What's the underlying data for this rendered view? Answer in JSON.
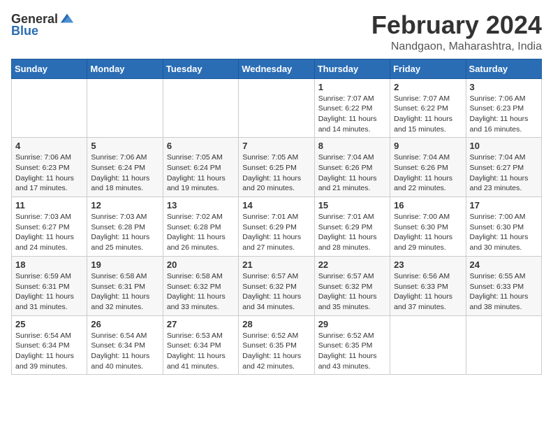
{
  "header": {
    "logo_general": "General",
    "logo_blue": "Blue",
    "month_year": "February 2024",
    "location": "Nandgaon, Maharashtra, India"
  },
  "days_of_week": [
    "Sunday",
    "Monday",
    "Tuesday",
    "Wednesday",
    "Thursday",
    "Friday",
    "Saturday"
  ],
  "weeks": [
    [
      {
        "day": "",
        "info": ""
      },
      {
        "day": "",
        "info": ""
      },
      {
        "day": "",
        "info": ""
      },
      {
        "day": "",
        "info": ""
      },
      {
        "day": "1",
        "info": "Sunrise: 7:07 AM\nSunset: 6:22 PM\nDaylight: 11 hours and 14 minutes."
      },
      {
        "day": "2",
        "info": "Sunrise: 7:07 AM\nSunset: 6:22 PM\nDaylight: 11 hours and 15 minutes."
      },
      {
        "day": "3",
        "info": "Sunrise: 7:06 AM\nSunset: 6:23 PM\nDaylight: 11 hours and 16 minutes."
      }
    ],
    [
      {
        "day": "4",
        "info": "Sunrise: 7:06 AM\nSunset: 6:23 PM\nDaylight: 11 hours and 17 minutes."
      },
      {
        "day": "5",
        "info": "Sunrise: 7:06 AM\nSunset: 6:24 PM\nDaylight: 11 hours and 18 minutes."
      },
      {
        "day": "6",
        "info": "Sunrise: 7:05 AM\nSunset: 6:24 PM\nDaylight: 11 hours and 19 minutes."
      },
      {
        "day": "7",
        "info": "Sunrise: 7:05 AM\nSunset: 6:25 PM\nDaylight: 11 hours and 20 minutes."
      },
      {
        "day": "8",
        "info": "Sunrise: 7:04 AM\nSunset: 6:26 PM\nDaylight: 11 hours and 21 minutes."
      },
      {
        "day": "9",
        "info": "Sunrise: 7:04 AM\nSunset: 6:26 PM\nDaylight: 11 hours and 22 minutes."
      },
      {
        "day": "10",
        "info": "Sunrise: 7:04 AM\nSunset: 6:27 PM\nDaylight: 11 hours and 23 minutes."
      }
    ],
    [
      {
        "day": "11",
        "info": "Sunrise: 7:03 AM\nSunset: 6:27 PM\nDaylight: 11 hours and 24 minutes."
      },
      {
        "day": "12",
        "info": "Sunrise: 7:03 AM\nSunset: 6:28 PM\nDaylight: 11 hours and 25 minutes."
      },
      {
        "day": "13",
        "info": "Sunrise: 7:02 AM\nSunset: 6:28 PM\nDaylight: 11 hours and 26 minutes."
      },
      {
        "day": "14",
        "info": "Sunrise: 7:01 AM\nSunset: 6:29 PM\nDaylight: 11 hours and 27 minutes."
      },
      {
        "day": "15",
        "info": "Sunrise: 7:01 AM\nSunset: 6:29 PM\nDaylight: 11 hours and 28 minutes."
      },
      {
        "day": "16",
        "info": "Sunrise: 7:00 AM\nSunset: 6:30 PM\nDaylight: 11 hours and 29 minutes."
      },
      {
        "day": "17",
        "info": "Sunrise: 7:00 AM\nSunset: 6:30 PM\nDaylight: 11 hours and 30 minutes."
      }
    ],
    [
      {
        "day": "18",
        "info": "Sunrise: 6:59 AM\nSunset: 6:31 PM\nDaylight: 11 hours and 31 minutes."
      },
      {
        "day": "19",
        "info": "Sunrise: 6:58 AM\nSunset: 6:31 PM\nDaylight: 11 hours and 32 minutes."
      },
      {
        "day": "20",
        "info": "Sunrise: 6:58 AM\nSunset: 6:32 PM\nDaylight: 11 hours and 33 minutes."
      },
      {
        "day": "21",
        "info": "Sunrise: 6:57 AM\nSunset: 6:32 PM\nDaylight: 11 hours and 34 minutes."
      },
      {
        "day": "22",
        "info": "Sunrise: 6:57 AM\nSunset: 6:32 PM\nDaylight: 11 hours and 35 minutes."
      },
      {
        "day": "23",
        "info": "Sunrise: 6:56 AM\nSunset: 6:33 PM\nDaylight: 11 hours and 37 minutes."
      },
      {
        "day": "24",
        "info": "Sunrise: 6:55 AM\nSunset: 6:33 PM\nDaylight: 11 hours and 38 minutes."
      }
    ],
    [
      {
        "day": "25",
        "info": "Sunrise: 6:54 AM\nSunset: 6:34 PM\nDaylight: 11 hours and 39 minutes."
      },
      {
        "day": "26",
        "info": "Sunrise: 6:54 AM\nSunset: 6:34 PM\nDaylight: 11 hours and 40 minutes."
      },
      {
        "day": "27",
        "info": "Sunrise: 6:53 AM\nSunset: 6:34 PM\nDaylight: 11 hours and 41 minutes."
      },
      {
        "day": "28",
        "info": "Sunrise: 6:52 AM\nSunset: 6:35 PM\nDaylight: 11 hours and 42 minutes."
      },
      {
        "day": "29",
        "info": "Sunrise: 6:52 AM\nSunset: 6:35 PM\nDaylight: 11 hours and 43 minutes."
      },
      {
        "day": "",
        "info": ""
      },
      {
        "day": "",
        "info": ""
      }
    ]
  ]
}
